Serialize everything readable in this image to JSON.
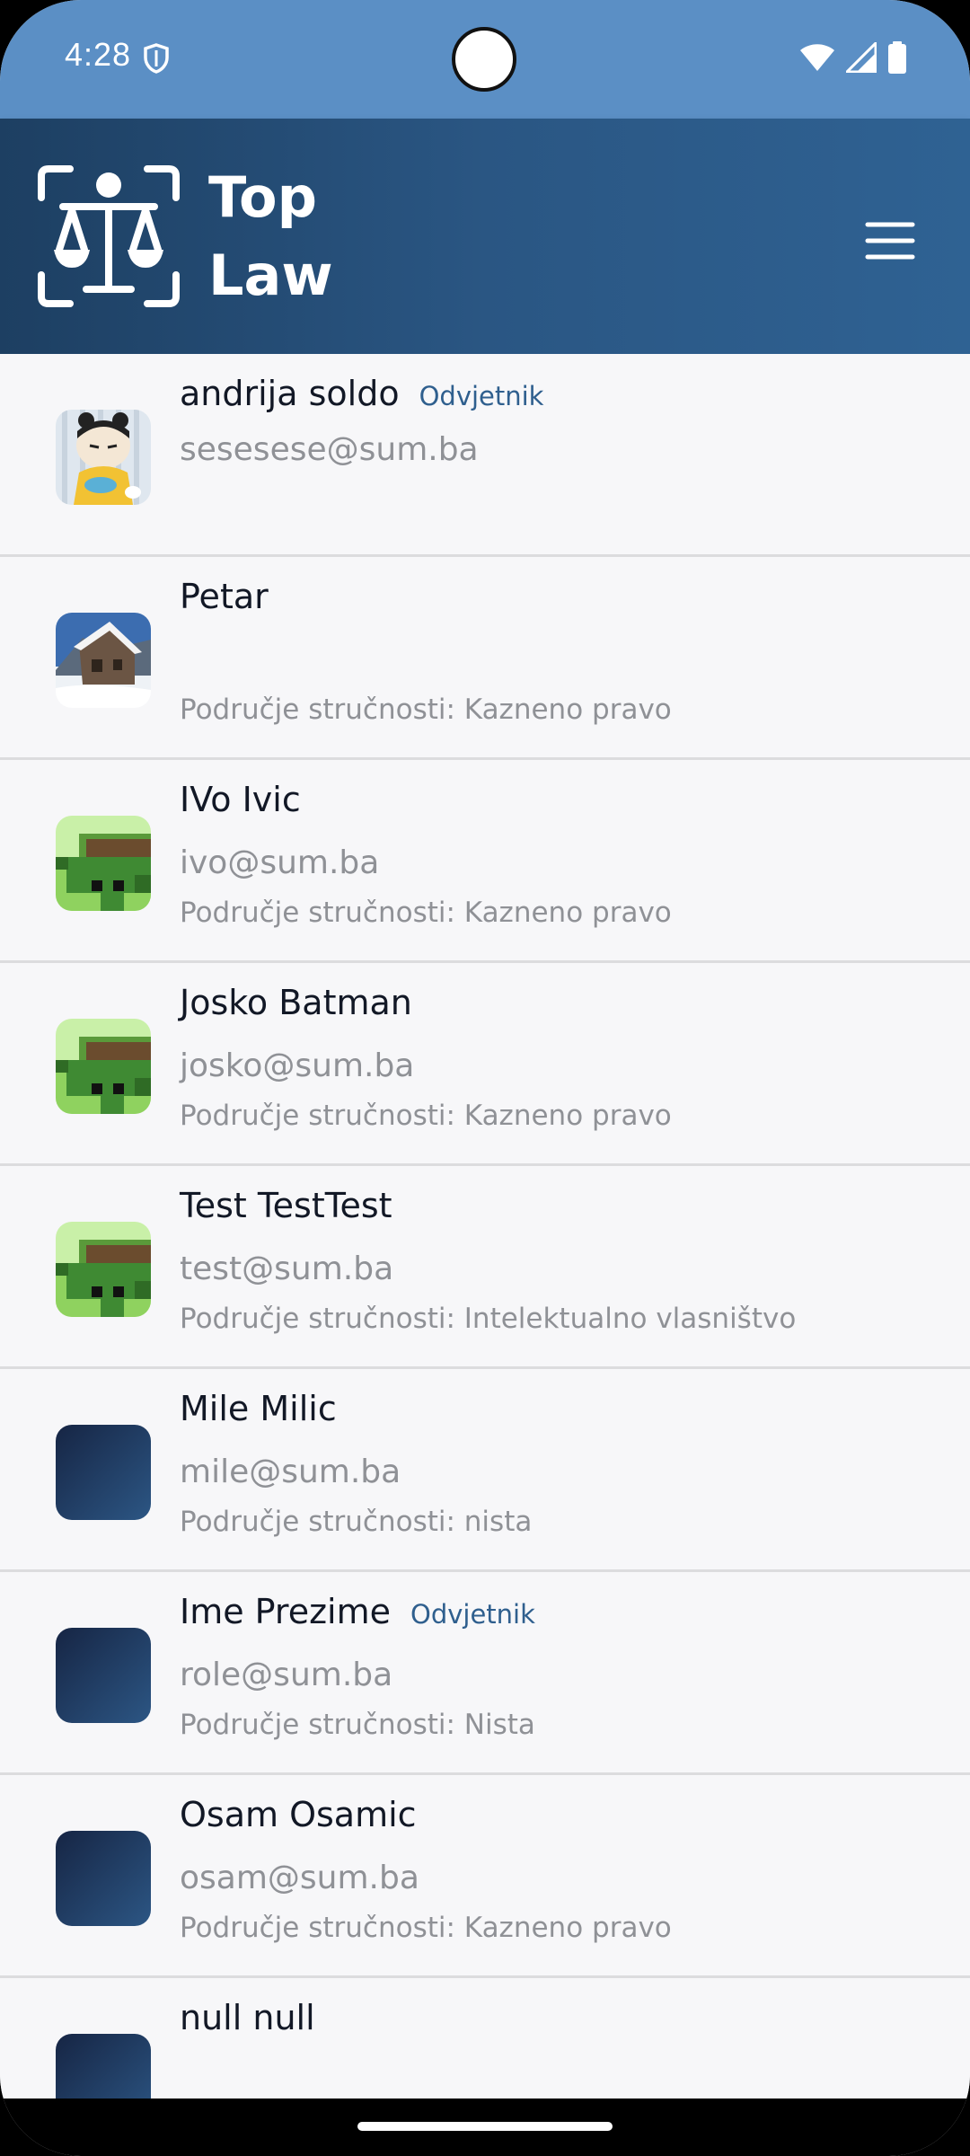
{
  "status_bar": {
    "time": "4:28",
    "icons": [
      "shield-icon",
      "wifi-icon",
      "cellular-signal-icon",
      "battery-icon"
    ]
  },
  "header": {
    "title": "Top Law",
    "logo": "scales-of-justice-icon",
    "menu": "hamburger-menu-icon",
    "colors": {
      "status_bar": "#5b8fc5",
      "header_dark": "#1d3f62",
      "header_light": "#2f6293",
      "accent": "#2f5f8e"
    }
  },
  "users": [
    {
      "name": "andrija soldo",
      "role": "Odvjetnik",
      "email": "sesesese@sum.ba",
      "expertise": "",
      "avatar": "cartoon-avatar"
    },
    {
      "name": "Petar",
      "role": "",
      "email": "",
      "expertise": "Područje stručnosti: Kazneno pravo",
      "avatar": "cabin-photo-avatar"
    },
    {
      "name": "IVo Ivic",
      "role": "",
      "email": "ivo@sum.ba",
      "expertise": "Područje stručnosti: Kazneno pravo",
      "avatar": "pixel-art-avatar"
    },
    {
      "name": "Josko Batman",
      "role": "",
      "email": "josko@sum.ba",
      "expertise": "Područje stručnosti: Kazneno pravo",
      "avatar": "pixel-art-avatar"
    },
    {
      "name": "Test TestTest",
      "role": "",
      "email": "test@sum.ba",
      "expertise": "Područje stručnosti: Intelektualno vlasništvo",
      "avatar": "pixel-art-avatar"
    },
    {
      "name": "Mile Milic",
      "role": "",
      "email": "mile@sum.ba",
      "expertise": "Područje stručnosti: nista",
      "avatar": "gradient-avatar"
    },
    {
      "name": "Ime Prezime",
      "role": "Odvjetnik",
      "email": "role@sum.ba",
      "expertise": "Područje stručnosti: Nista",
      "avatar": "gradient-avatar"
    },
    {
      "name": "Osam Osamic",
      "role": "",
      "email": "osam@sum.ba",
      "expertise": "Područje stručnosti: Kazneno pravo",
      "avatar": "gradient-avatar"
    },
    {
      "name": "null null",
      "role": "",
      "email": "",
      "expertise": "",
      "avatar": "gradient-avatar"
    }
  ]
}
